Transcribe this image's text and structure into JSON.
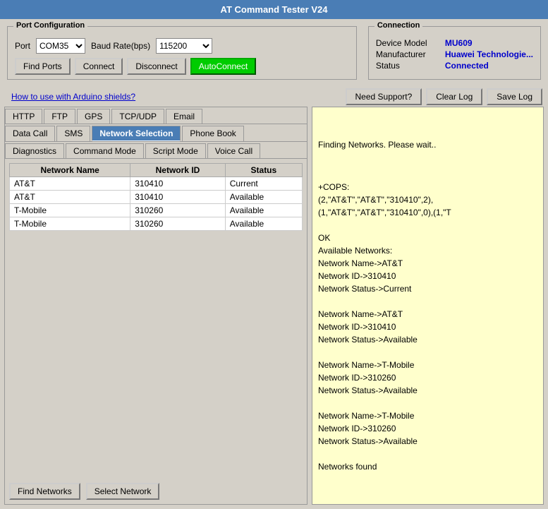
{
  "title": "AT Command Tester V24",
  "port_config": {
    "label": "Port Configuration",
    "port_label": "Port",
    "port_value": "COM35",
    "baud_label": "Baud Rate(bps)",
    "baud_value": "115200",
    "find_ports": "Find Ports",
    "connect": "Connect",
    "disconnect": "Disconnect",
    "autoconnect": "AutoConnect"
  },
  "connection": {
    "label": "Connection",
    "device_model_label": "Device Model",
    "device_model_value": "MU609",
    "manufacturer_label": "Manufacturer",
    "manufacturer_value": "Huawei Technologie...",
    "status_label": "Status",
    "status_value": "Connected"
  },
  "help_link": "How to use with Arduino shields?",
  "support_btn": "Need Support?",
  "clear_log_btn": "Clear Log",
  "save_log_btn": "Save Log",
  "tabs_row1": [
    "HTTP",
    "FTP",
    "GPS",
    "TCP/UDP",
    "Email"
  ],
  "tabs_row2": [
    "Data Call",
    "SMS",
    "Network Selection",
    "Phone Book"
  ],
  "tabs_row3": [
    "Diagnostics",
    "Command Mode",
    "Script Mode",
    "Voice Call"
  ],
  "active_tab": "Network Selection",
  "table": {
    "headers": [
      "Network Name",
      "Network ID",
      "Status"
    ],
    "rows": [
      {
        "name": "AT&T",
        "id": "310410",
        "status": "Current"
      },
      {
        "name": "AT&T",
        "id": "310410",
        "status": "Available"
      },
      {
        "name": "T-Mobile",
        "id": "310260",
        "status": "Available"
      },
      {
        "name": "T-Mobile",
        "id": "310260",
        "status": "Available"
      }
    ]
  },
  "find_networks_btn": "Find Networks",
  "select_network_btn": "Select Network",
  "log_content": "+COPS:\n(2,\"AT&T\",\"AT&T\",\"310410\",2),(1,\"AT&T\",\"AT&T\",\"310410\",0),(1,\"T\n\nOK\nAvailable Networks:\nNetwork Name->AT&T\nNetwork ID->310410\nNetwork Status->Current\n\nNetwork Name->AT&T\nNetwork ID->310410\nNetwork Status->Available\n\nNetwork Name->T-Mobile\nNetwork ID->310260\nNetwork Status->Available\n\nNetwork Name->T-Mobile\nNetwork ID->310260\nNetwork Status->Available\n\nNetworks found",
  "log_header": "Finding Networks. Please wait.."
}
